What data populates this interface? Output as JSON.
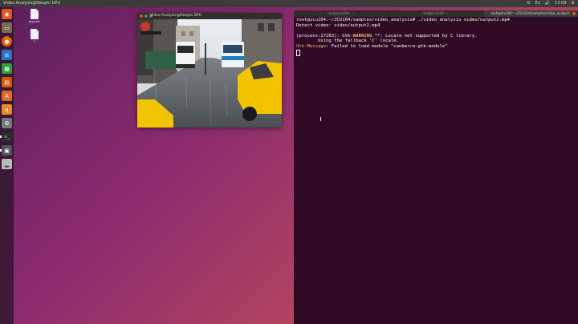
{
  "topbar": {
    "window_title": "Video Analysis@Deephi DPU",
    "indicators": [
      "⇅",
      "En",
      "🔊",
      "13:09",
      "⚙"
    ]
  },
  "launcher": {
    "items": [
      {
        "icon": "ubuntu-dash-icon",
        "glyph": "◉",
        "color": "#e95420",
        "active": false
      },
      {
        "icon": "files-icon",
        "glyph": "▭",
        "color": "#7d6a55",
        "active": false
      },
      {
        "icon": "firefox-icon",
        "glyph": "●",
        "color": "#e66000",
        "active": false
      },
      {
        "icon": "writer-icon",
        "glyph": "≡",
        "color": "#2a73c9",
        "active": false
      },
      {
        "icon": "calc-icon",
        "glyph": "▦",
        "color": "#2e9d3a",
        "active": false
      },
      {
        "icon": "impress-icon",
        "glyph": "▤",
        "color": "#d35b00",
        "active": false
      },
      {
        "icon": "software-center-icon",
        "glyph": "A",
        "color": "#e3672a",
        "active": false
      },
      {
        "icon": "amazon-icon",
        "glyph": "a",
        "color": "#e68a2a",
        "active": false
      },
      {
        "icon": "settings-icon",
        "glyph": "⚙",
        "color": "#777777",
        "active": false
      },
      {
        "icon": "terminal-icon",
        "glyph": ">_",
        "color": "#2c2c2c",
        "active": true
      },
      {
        "icon": "video-window-icon",
        "glyph": "▣",
        "color": "#555555",
        "active": true
      },
      {
        "icon": "drive-icon",
        "glyph": "▂",
        "color": "#bbbbbb",
        "active": false
      }
    ]
  },
  "desktop_icons": [
    {
      "name": "file-icon-1",
      "label": "grys.txt"
    },
    {
      "name": "file-icon-2",
      "label": "1"
    }
  ],
  "video_window": {
    "title": "Video Analysis@Deephi DPU"
  },
  "terminal": {
    "tabs": [
      "root@zcu104: ~",
      "root@zcu104: ~",
      "root@zcu104: ~/ZCU104/samples/video_analysis"
    ],
    "lines": {
      "l1": "root@zcu104:~/ZCU104/samples/video_analysis# ./video_analysis video/output2.mp4",
      "l2": "Detect video: video/output2.mp4",
      "l3": "",
      "l4a": "(process:17263): Gtk-",
      "l4b": "WARNING",
      "l4c": " **: Locale not supported by C library.",
      "l5": "        Using the fallback 'C' locale.",
      "l6a": "Gtk-Message",
      "l6b": ": Failed to load module \"canberra-gtk-module\""
    }
  }
}
